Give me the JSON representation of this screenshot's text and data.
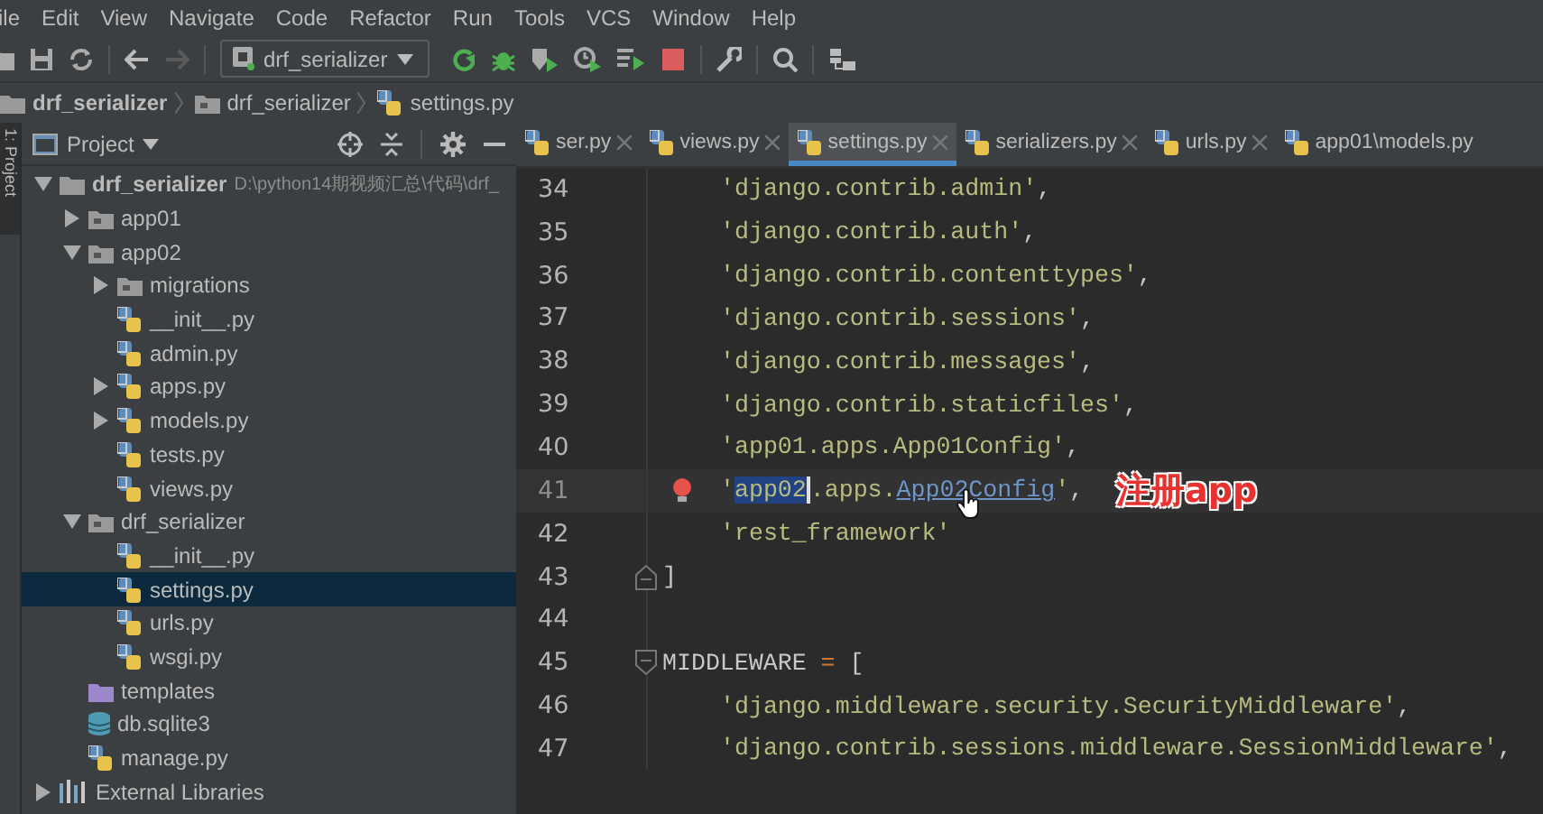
{
  "menu_bar": {
    "items": [
      "ile",
      "Edit",
      "View",
      "Navigate",
      "Code",
      "Refactor",
      "Run",
      "Tools",
      "VCS",
      "Window",
      "Help"
    ]
  },
  "toolbar": {
    "run_configuration": "drf_serializer"
  },
  "breadcrumbs": [
    {
      "label": "drf_serializer",
      "kind": "project"
    },
    {
      "label": "drf_serializer",
      "kind": "folder"
    },
    {
      "label": "settings.py",
      "kind": "python"
    }
  ],
  "side_strip": {
    "label": "1: Project"
  },
  "project_panel": {
    "title": "Project",
    "tree": [
      {
        "label": "drf_serializer",
        "kind": "project",
        "path": "D:\\python14期视频汇总\\代码\\drf_",
        "expanded": true,
        "selected": false,
        "children": [
          {
            "label": "app01",
            "kind": "folder",
            "expanded": false,
            "selected": false
          },
          {
            "label": "app02",
            "kind": "folder",
            "expanded": true,
            "selected": false,
            "children": [
              {
                "label": "migrations",
                "kind": "folder",
                "expanded": false,
                "selected": false
              },
              {
                "label": "__init__.py",
                "kind": "python",
                "selected": false
              },
              {
                "label": "admin.py",
                "kind": "python",
                "selected": false
              },
              {
                "label": "apps.py",
                "kind": "python",
                "expanded": false,
                "selected": false
              },
              {
                "label": "models.py",
                "kind": "python",
                "expanded": false,
                "selected": false
              },
              {
                "label": "tests.py",
                "kind": "python",
                "selected": false
              },
              {
                "label": "views.py",
                "kind": "python",
                "selected": false
              }
            ]
          },
          {
            "label": "drf_serializer",
            "kind": "folder",
            "expanded": true,
            "selected": false,
            "children": [
              {
                "label": "__init__.py",
                "kind": "python",
                "selected": false
              },
              {
                "label": "settings.py",
                "kind": "python",
                "selected": true
              },
              {
                "label": "urls.py",
                "kind": "python",
                "selected": false
              },
              {
                "label": "wsgi.py",
                "kind": "python",
                "selected": false
              }
            ]
          },
          {
            "label": "templates",
            "kind": "templates",
            "selected": false
          },
          {
            "label": "db.sqlite3",
            "kind": "database",
            "selected": false
          },
          {
            "label": "manage.py",
            "kind": "python",
            "selected": false
          }
        ]
      },
      {
        "label": "External Libraries",
        "kind": "libraries",
        "expanded": false,
        "selected": false
      }
    ]
  },
  "editor": {
    "tabs": [
      {
        "label": "ser.py",
        "selected": false,
        "closable": true
      },
      {
        "label": "views.py",
        "selected": false,
        "closable": true
      },
      {
        "label": "settings.py",
        "selected": true,
        "closable": true
      },
      {
        "label": "serializers.py",
        "selected": false,
        "closable": true
      },
      {
        "label": "urls.py",
        "selected": false,
        "closable": true
      },
      {
        "label": "app01\\models.py",
        "selected": false,
        "closable": false
      }
    ],
    "lines": [
      {
        "kind": "block",
        "children": [
          {
            "kind": "line",
            "number": "34",
            "current": false,
            "tokens": [
              {
                "text": "'django.contrib.admin'",
                "kind": "string"
              },
              {
                "text": ",",
                "kind": "plain"
              }
            ]
          },
          {
            "kind": "line",
            "number": "35",
            "current": false,
            "tokens": [
              {
                "text": "'django.contrib.auth'",
                "kind": "string"
              },
              {
                "text": ",",
                "kind": "plain"
              }
            ]
          },
          {
            "kind": "line",
            "number": "36",
            "current": false,
            "tokens": [
              {
                "text": "'django.contrib.contenttypes'",
                "kind": "string"
              },
              {
                "text": ",",
                "kind": "plain"
              }
            ]
          },
          {
            "kind": "line",
            "number": "37",
            "current": false,
            "tokens": [
              {
                "text": "'django.contrib.sessions'",
                "kind": "string"
              },
              {
                "text": ",",
                "kind": "plain"
              }
            ]
          },
          {
            "kind": "line",
            "number": "38",
            "current": false,
            "tokens": [
              {
                "text": "'django.contrib.messages'",
                "kind": "string"
              },
              {
                "text": ",",
                "kind": "plain"
              }
            ]
          },
          {
            "kind": "line",
            "number": "39",
            "current": false,
            "tokens": [
              {
                "text": "'django.contrib.staticfiles'",
                "kind": "string"
              },
              {
                "text": ",",
                "kind": "plain"
              }
            ]
          },
          {
            "kind": "line",
            "number": "40",
            "current": false,
            "tokens": [
              {
                "text": "'app01.apps.App01Config'",
                "kind": "string"
              },
              {
                "text": ",",
                "kind": "plain"
              }
            ]
          },
          {
            "kind": "line",
            "number": "41",
            "current": true,
            "tokens": [
              {
                "text": "'",
                "kind": "string"
              },
              {
                "text": "app02",
                "kind": "selected"
              },
              {
                "text": ".apps.",
                "kind": "string"
              },
              {
                "text": "App02Config",
                "kind": "link"
              },
              {
                "text": "'",
                "kind": "string"
              },
              {
                "text": ",",
                "kind": "plain"
              }
            ],
            "annotation": "注册app"
          },
          {
            "kind": "line",
            "number": "42",
            "current": false,
            "tokens": [
              {
                "text": "'rest_framework'",
                "kind": "string"
              }
            ]
          }
        ]
      },
      {
        "kind": "line",
        "number": "43",
        "current": false,
        "fold_end": true,
        "tokens": [
          {
            "text": "]",
            "kind": "plain"
          }
        ]
      },
      {
        "kind": "line",
        "number": "44",
        "current": false
      },
      {
        "kind": "line",
        "number": "45",
        "current": false,
        "fold_start": true,
        "tokens": [
          {
            "text": "MIDDLEWARE",
            "kind": "plain"
          },
          {
            "text": "=",
            "kind": "operator"
          },
          {
            "text": "[",
            "kind": "plain"
          }
        ],
        "children": [
          {
            "kind": "line",
            "number": "46",
            "current": false,
            "tokens": [
              {
                "text": "'django.middleware.security.SecurityMiddleware'",
                "kind": "string"
              },
              {
                "text": ",",
                "kind": "plain"
              }
            ]
          },
          {
            "kind": "line",
            "number": "47",
            "current": false,
            "tokens": [
              {
                "text": "'django.contrib.sessions.middleware.SessionMiddleware'",
                "kind": "string"
              },
              {
                "text": ",",
                "kind": "plain"
              }
            ]
          }
        ]
      }
    ]
  }
}
